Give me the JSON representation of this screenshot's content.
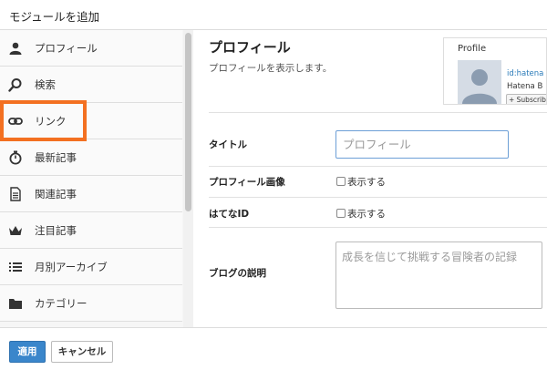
{
  "header": {
    "title": "モジュールを追加"
  },
  "sidebar": {
    "items": [
      {
        "label": "プロフィール",
        "icon": "person-icon"
      },
      {
        "label": "検索",
        "icon": "search-icon"
      },
      {
        "label": "リンク",
        "icon": "link-icon"
      },
      {
        "label": "最新記事",
        "icon": "stopwatch-icon"
      },
      {
        "label": "関連記事",
        "icon": "document-icon"
      },
      {
        "label": "注目記事",
        "icon": "crown-icon"
      },
      {
        "label": "月別アーカイブ",
        "icon": "list-icon"
      },
      {
        "label": "カテゴリー",
        "icon": "folder-icon"
      }
    ]
  },
  "main": {
    "title": "プロフィール",
    "description": "プロフィールを表示します。",
    "preview": {
      "title": "Profile",
      "id_text": "id:hatena",
      "name_text": "Hatena B",
      "button_text": "+ Subscribe"
    },
    "fields": {
      "title_label": "タイトル",
      "title_placeholder": "プロフィール",
      "image_label": "プロフィール画像",
      "image_checkbox": "表示する",
      "hatena_id_label": "はてなID",
      "hatena_id_checkbox": "表示する",
      "blog_desc_label": "ブログの説明",
      "blog_desc_placeholder": "成長を信じて挑戦する冒険者の記録"
    }
  },
  "footer": {
    "apply_label": "適用",
    "cancel_label": "キャンセル"
  },
  "colors": {
    "accent": "#3a86cb",
    "highlight": "#f37021"
  }
}
